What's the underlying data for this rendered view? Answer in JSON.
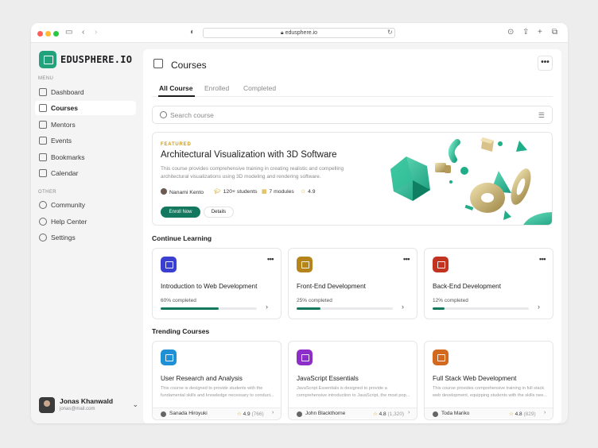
{
  "browser": {
    "url": "edusphere.io"
  },
  "app": {
    "logo": "EDUSPHERE.IO"
  },
  "sidebar": {
    "menu_label": "MENU",
    "other_label": "OTHER",
    "menu": [
      {
        "label": "Dashboard",
        "icon": "home-icon"
      },
      {
        "label": "Courses",
        "icon": "courses-icon",
        "active": true
      },
      {
        "label": "Mentors",
        "icon": "mentors-icon"
      },
      {
        "label": "Events",
        "icon": "events-icon"
      },
      {
        "label": "Bookmarks",
        "icon": "bookmarks-icon"
      },
      {
        "label": "Calendar",
        "icon": "calendar-icon"
      }
    ],
    "other": [
      {
        "label": "Community",
        "icon": "community-icon"
      },
      {
        "label": "Help Center",
        "icon": "help-icon"
      },
      {
        "label": "Settings",
        "icon": "gear-icon"
      }
    ]
  },
  "user": {
    "name": "Jonas Khanwald",
    "email": "jonas@mail.com"
  },
  "header": {
    "title": "Courses",
    "more": "•••"
  },
  "tabs": [
    "All Course",
    "Enrolled",
    "Completed"
  ],
  "search": {
    "placeholder": "Search course"
  },
  "featured": {
    "label": "FEATURED",
    "title": "Architectural Visualization with 3D Software",
    "description": "This course provides comprehensive training in creating realistic and compelling architectural visualizations using 3D modeling and rendering software.",
    "mentor": "Nanami Kento",
    "students": "120+ students",
    "modules": "7 modules",
    "rating": "4.9",
    "enroll_label": "Enroll Now",
    "details_label": "Details"
  },
  "continue": {
    "title": "Continue Learning",
    "cards": [
      {
        "title": "Introduction to Web Development",
        "progress_text": "60% completed",
        "progress": 0.6,
        "color": "#3b3fcf"
      },
      {
        "title": "Front-End Development",
        "progress_text": "25% completed",
        "progress": 0.25,
        "color": "#b5841a"
      },
      {
        "title": "Back-End Development",
        "progress_text": "12% completed",
        "progress": 0.12,
        "color": "#c2341f"
      }
    ]
  },
  "trending": {
    "title": "Trending Courses",
    "cards": [
      {
        "title": "User Research and Analysis",
        "desc": "This course is designed to provide students with the fundamental skills and knowledge necessary to conduct...",
        "author": "Sanada Hiroyuki",
        "rating": "4.9",
        "count": "(766)",
        "color": "#1f8fd6"
      },
      {
        "title": "JavaScript Essentials",
        "desc": "JavaScript Essentials is designed to provide a comprehensive introduction to JavaScript, the most pop...",
        "author": "John Blackthorne",
        "rating": "4.8",
        "count": "(1,320)",
        "color": "#8e2ec9"
      },
      {
        "title": "Full Stack Web Development",
        "desc": "This course provides comprehensive training in full stack web development, equipping students with the skills nee...",
        "author": "Toda Mariko",
        "rating": "4.8",
        "count": "(829)",
        "color": "#d2691e"
      }
    ]
  }
}
